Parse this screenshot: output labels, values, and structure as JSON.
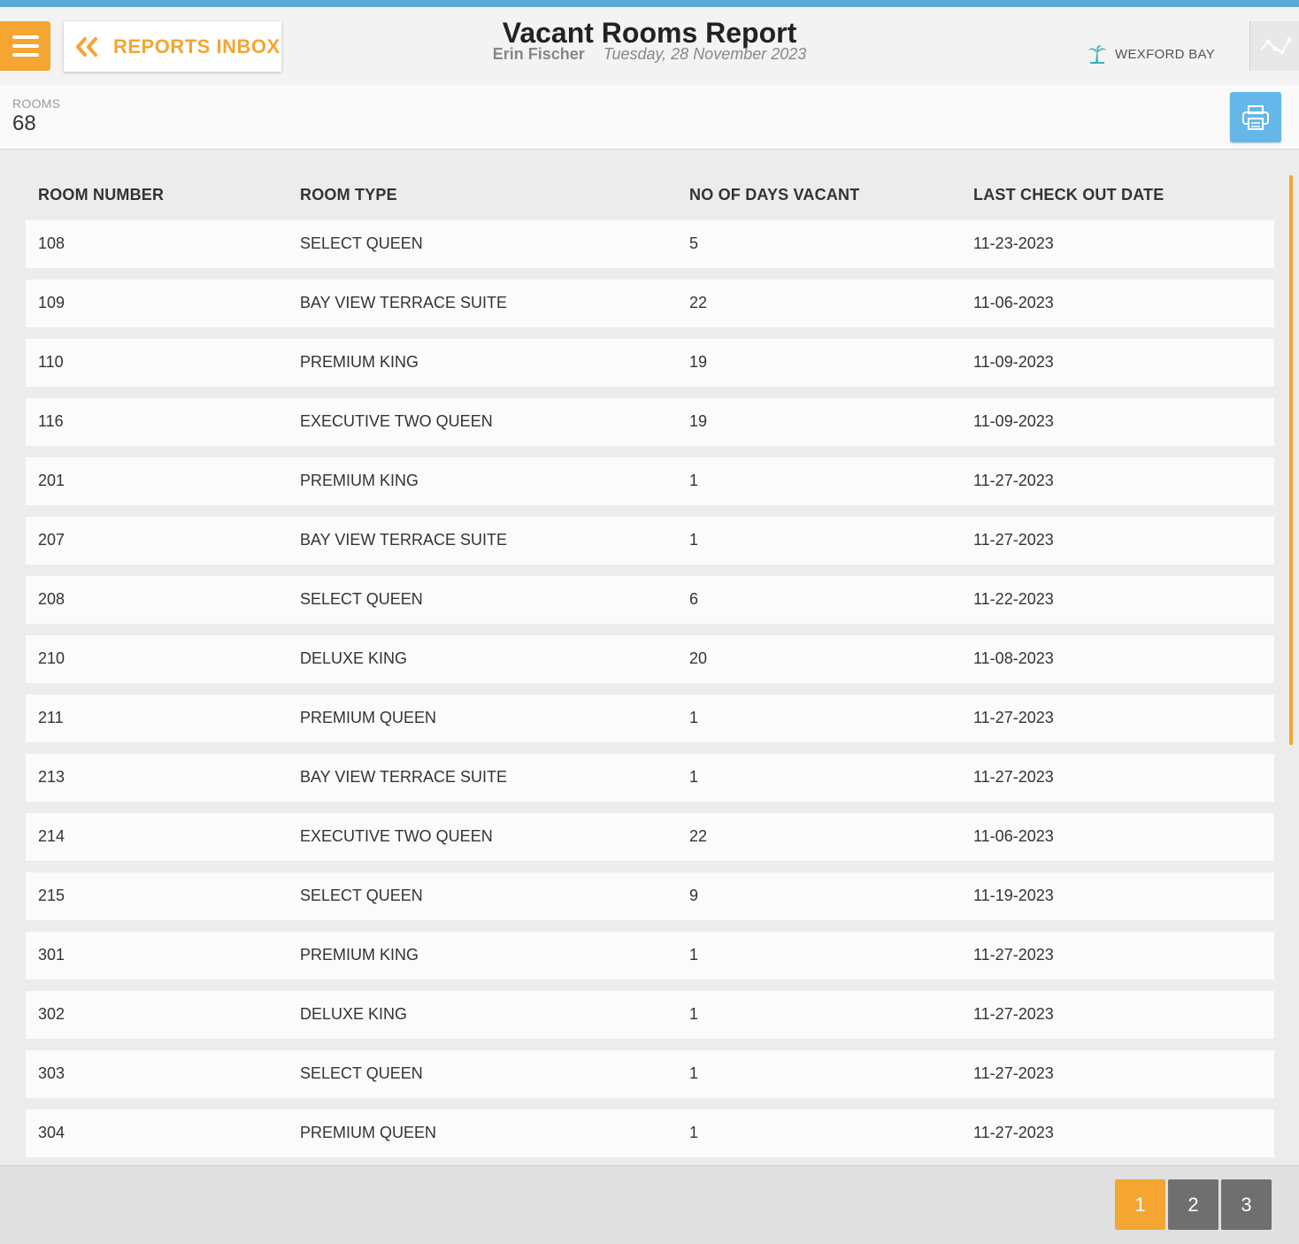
{
  "header": {
    "back_label": "REPORTS INBOX",
    "title": "Vacant Rooms Report",
    "user": "Erin Fischer",
    "date": "Tuesday, 28 November 2023",
    "brand": "WEXFORD BAY"
  },
  "summary": {
    "label": "ROOMS",
    "value": "68"
  },
  "table": {
    "columns": [
      "ROOM NUMBER",
      "ROOM TYPE",
      "NO OF DAYS VACANT",
      "LAST CHECK OUT DATE"
    ],
    "rows": [
      [
        "108",
        "SELECT QUEEN",
        "5",
        "11-23-2023"
      ],
      [
        "109",
        "BAY VIEW TERRACE SUITE",
        "22",
        "11-06-2023"
      ],
      [
        "110",
        "PREMIUM KING",
        "19",
        "11-09-2023"
      ],
      [
        "116",
        "EXECUTIVE TWO QUEEN",
        "19",
        "11-09-2023"
      ],
      [
        "201",
        "PREMIUM KING",
        "1",
        "11-27-2023"
      ],
      [
        "207",
        "BAY VIEW TERRACE SUITE",
        "1",
        "11-27-2023"
      ],
      [
        "208",
        "SELECT QUEEN",
        "6",
        "11-22-2023"
      ],
      [
        "210",
        "DELUXE KING",
        "20",
        "11-08-2023"
      ],
      [
        "211",
        "PREMIUM QUEEN",
        "1",
        "11-27-2023"
      ],
      [
        "213",
        "BAY VIEW TERRACE SUITE",
        "1",
        "11-27-2023"
      ],
      [
        "214",
        "EXECUTIVE TWO QUEEN",
        "22",
        "11-06-2023"
      ],
      [
        "215",
        "SELECT QUEEN",
        "9",
        "11-19-2023"
      ],
      [
        "301",
        "PREMIUM KING",
        "1",
        "11-27-2023"
      ],
      [
        "302",
        "DELUXE KING",
        "1",
        "11-27-2023"
      ],
      [
        "303",
        "SELECT QUEEN",
        "1",
        "11-27-2023"
      ],
      [
        "304",
        "PREMIUM QUEEN",
        "1",
        "11-27-2023"
      ]
    ]
  },
  "pagination": {
    "pages": [
      "1",
      "2",
      "3"
    ],
    "current": "1"
  },
  "colors": {
    "accent": "#f4a532",
    "print": "#63b8e9",
    "brand_icon": "#3bb0b8"
  },
  "icons": {
    "menu": "hamburger-icon",
    "back": "double-chevron-left-icon",
    "brand": "palm-tree-icon",
    "chart": "line-chart-icon",
    "print": "printer-icon"
  }
}
